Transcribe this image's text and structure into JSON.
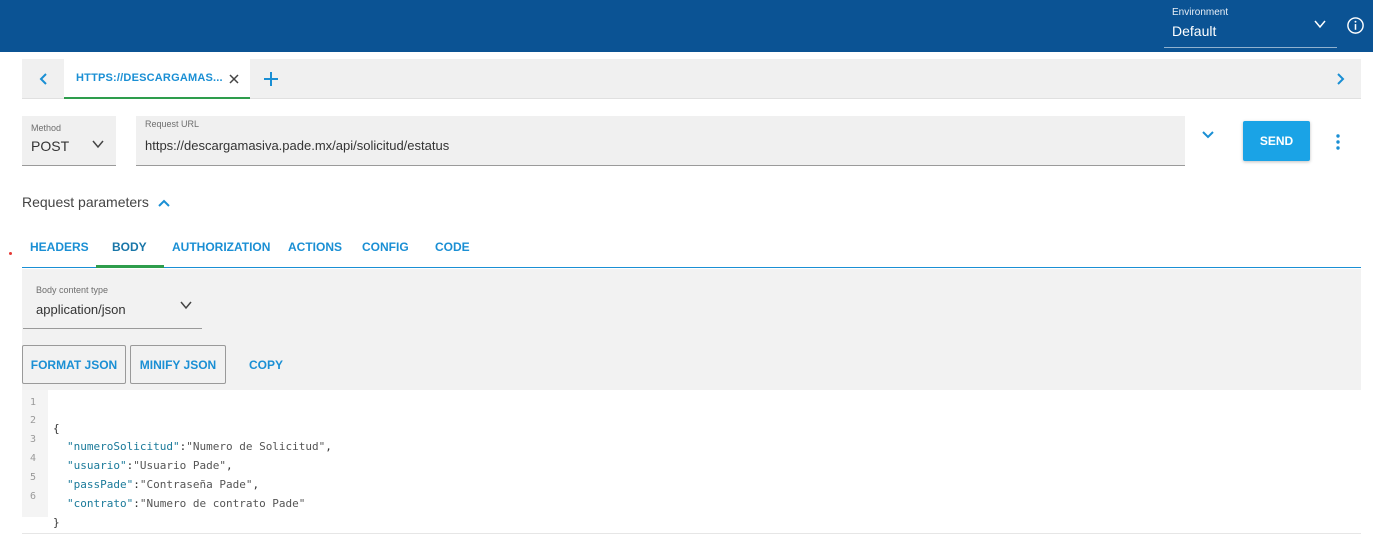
{
  "environment": {
    "label": "Environment",
    "value": "Default"
  },
  "request_tab": {
    "label": "HTTPS://DESCARGAMAS..."
  },
  "method": {
    "label": "Method",
    "value": "POST"
  },
  "url": {
    "label": "Request URL",
    "value": "https://descargamasiva.pade.mx/api/solicitud/estatus"
  },
  "send_label": "SEND",
  "request_parameters_label": "Request parameters",
  "param_tabs": [
    {
      "label": "HEADERS"
    },
    {
      "label": "BODY"
    },
    {
      "label": "AUTHORIZATION"
    },
    {
      "label": "ACTIONS"
    },
    {
      "label": "CONFIG"
    },
    {
      "label": "CODE"
    }
  ],
  "active_param_tab": "BODY",
  "body_content_type": {
    "label": "Body content type",
    "value": "application/json"
  },
  "body_actions": {
    "format": "FORMAT JSON",
    "minify": "MINIFY JSON",
    "copy": "COPY"
  },
  "code_lines": [
    {
      "n": "1",
      "key": "",
      "val": "",
      "text": "{"
    },
    {
      "n": "2",
      "key": "\"numeroSolicitud\"",
      "val": "\"Numero de Solicitud\"",
      "tail": ","
    },
    {
      "n": "3",
      "key": "\"usuario\"",
      "val": "\"Usuario Pade\"",
      "tail": ","
    },
    {
      "n": "4",
      "key": "\"passPade\"",
      "val": "\"Contraseña Pade\"",
      "tail": ","
    },
    {
      "n": "5",
      "key": "\"contrato\"",
      "val": "\"Numero de contrato Pade\"",
      "tail": ""
    },
    {
      "n": "6",
      "key": "",
      "val": "",
      "text": "}"
    }
  ],
  "colors": {
    "topbar": "#0b5394",
    "accent": "#1a8fd4",
    "active_underline": "#2e9d4c",
    "send": "#1aa3e6"
  },
  "icons": [
    "chevron-down-icon",
    "info-icon",
    "chevron-left-icon",
    "close-icon",
    "plus-icon",
    "chevron-right-icon",
    "more-vertical-icon",
    "chevron-up-icon"
  ]
}
